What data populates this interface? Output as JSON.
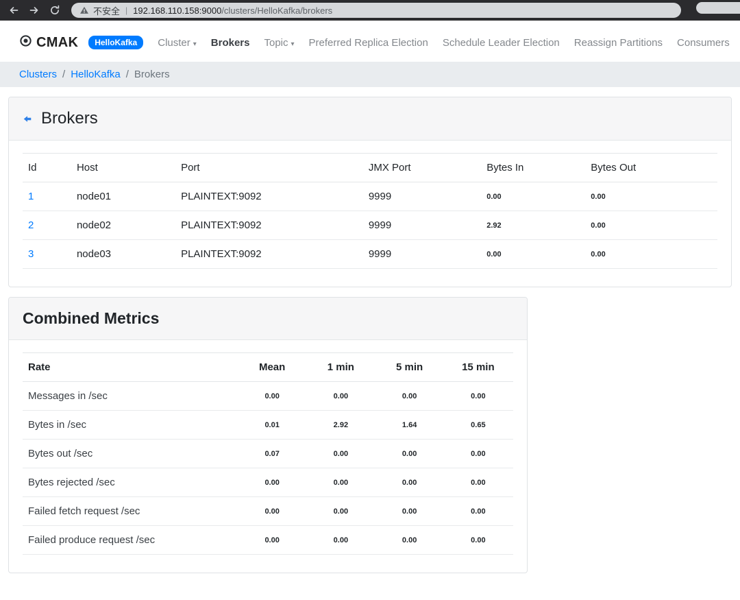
{
  "browser": {
    "security_label": "不安全",
    "separator": "|",
    "url_domain": "192.168.110.158:9000",
    "url_path": "/clusters/HelloKafka/brokers"
  },
  "navbar": {
    "brand": "CMAK",
    "cluster_badge": "HelloKafka",
    "items": [
      {
        "label": "Cluster",
        "dropdown": true
      },
      {
        "label": "Brokers",
        "active": true
      },
      {
        "label": "Topic",
        "dropdown": true
      },
      {
        "label": "Preferred Replica Election"
      },
      {
        "label": "Schedule Leader Election"
      },
      {
        "label": "Reassign Partitions"
      },
      {
        "label": "Consumers"
      }
    ]
  },
  "breadcrumb": {
    "separator": "/",
    "items": [
      {
        "label": "Clusters",
        "link": true
      },
      {
        "label": "HelloKafka",
        "link": true
      },
      {
        "label": "Brokers",
        "link": false
      }
    ]
  },
  "brokers_panel": {
    "title": "Brokers",
    "table": {
      "headers": [
        "Id",
        "Host",
        "Port",
        "JMX Port",
        "Bytes In",
        "Bytes Out"
      ],
      "rows": [
        {
          "id": "1",
          "host": "node01",
          "port": "PLAINTEXT:9092",
          "jmx_port": "9999",
          "bytes_in": "0.00",
          "bytes_out": "0.00"
        },
        {
          "id": "2",
          "host": "node02",
          "port": "PLAINTEXT:9092",
          "jmx_port": "9999",
          "bytes_in": "2.92",
          "bytes_out": "0.00"
        },
        {
          "id": "3",
          "host": "node03",
          "port": "PLAINTEXT:9092",
          "jmx_port": "9999",
          "bytes_in": "0.00",
          "bytes_out": "0.00"
        }
      ]
    }
  },
  "metrics_panel": {
    "title": "Combined Metrics",
    "table": {
      "headers": [
        "Rate",
        "Mean",
        "1 min",
        "5 min",
        "15 min"
      ],
      "rows": [
        {
          "rate": "Messages in /sec",
          "mean": "0.00",
          "m1": "0.00",
          "m5": "0.00",
          "m15": "0.00"
        },
        {
          "rate": "Bytes in /sec",
          "mean": "0.01",
          "m1": "2.92",
          "m5": "1.64",
          "m15": "0.65"
        },
        {
          "rate": "Bytes out /sec",
          "mean": "0.07",
          "m1": "0.00",
          "m5": "0.00",
          "m15": "0.00"
        },
        {
          "rate": "Bytes rejected /sec",
          "mean": "0.00",
          "m1": "0.00",
          "m5": "0.00",
          "m15": "0.00"
        },
        {
          "rate": "Failed fetch request /sec",
          "mean": "0.00",
          "m1": "0.00",
          "m5": "0.00",
          "m15": "0.00"
        },
        {
          "rate": "Failed produce request /sec",
          "mean": "0.00",
          "m1": "0.00",
          "m5": "0.00",
          "m15": "0.00"
        }
      ]
    }
  },
  "colors": {
    "link": "#007bff",
    "badge": "#007bff",
    "breadcrumb_bg": "#e9ecef",
    "browser_bar_bg": "#2b2b2e"
  }
}
